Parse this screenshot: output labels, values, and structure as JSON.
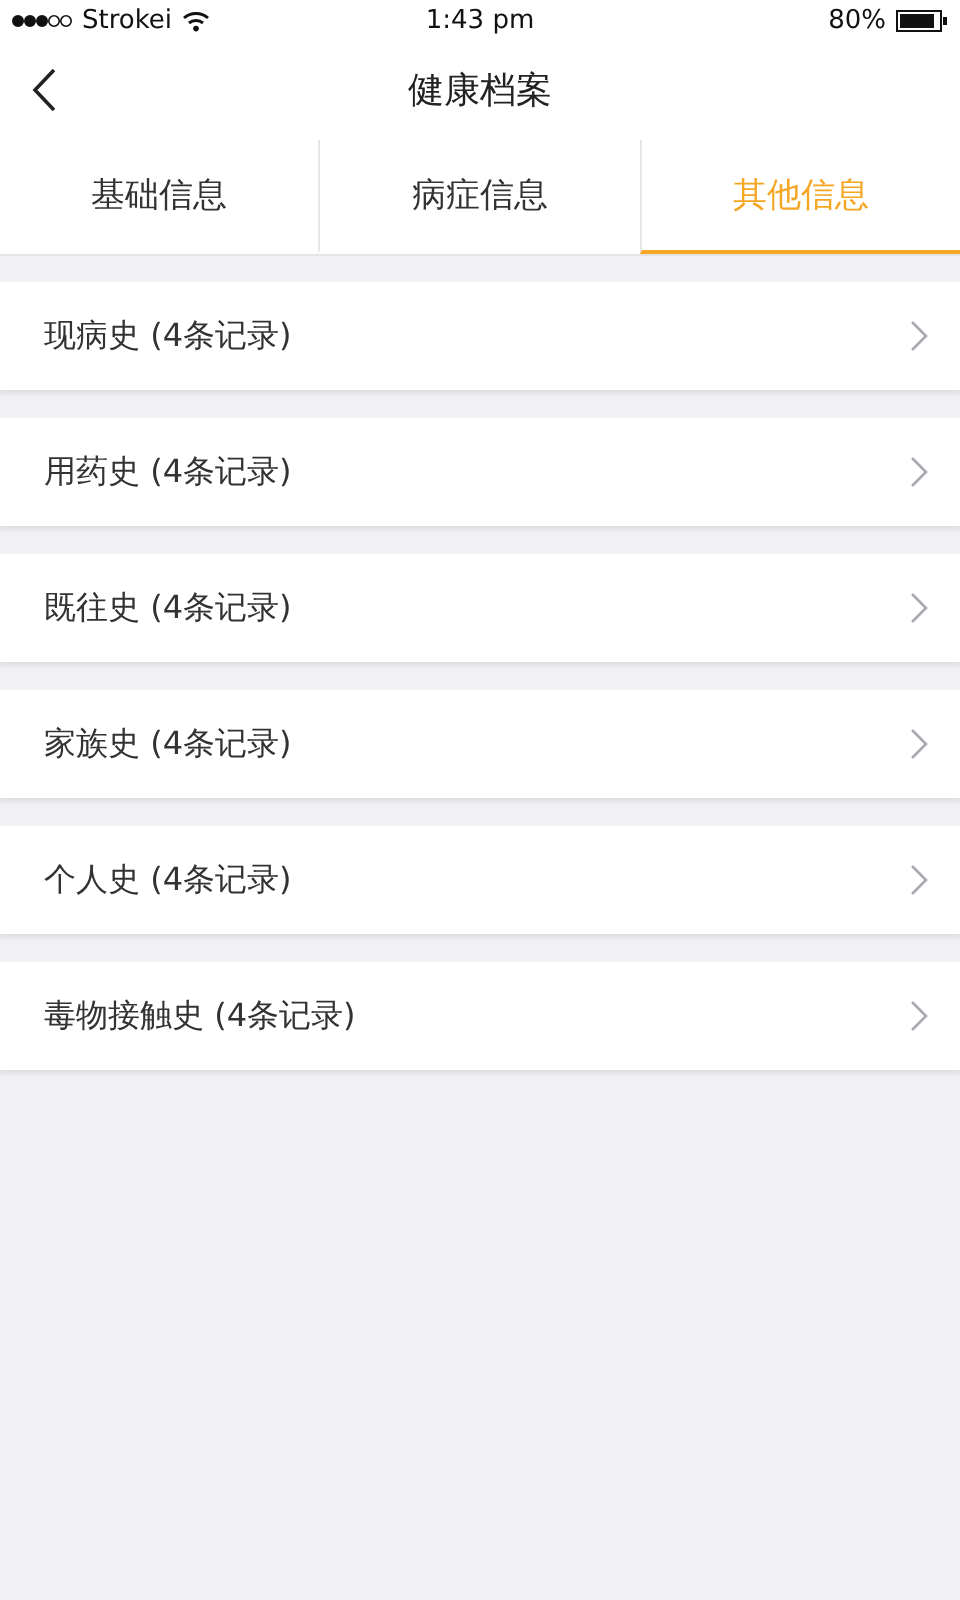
{
  "status_bar": {
    "carrier": "Strokei",
    "time": "1:43 pm",
    "battery": "80%"
  },
  "nav": {
    "title": "健康档案"
  },
  "tabs": [
    {
      "label": "基础信息",
      "selected": false
    },
    {
      "label": "病症信息",
      "selected": false
    },
    {
      "label": "其他信息",
      "selected": true
    }
  ],
  "items": [
    {
      "label": "现病史 (4条记录)"
    },
    {
      "label": "用药史 (4条记录)"
    },
    {
      "label": "既往史 (4条记录)"
    },
    {
      "label": "家族史 (4条记录)"
    },
    {
      "label": "个人史 (4条记录)"
    },
    {
      "label": "毒物接触史 (4条记录)"
    }
  ]
}
